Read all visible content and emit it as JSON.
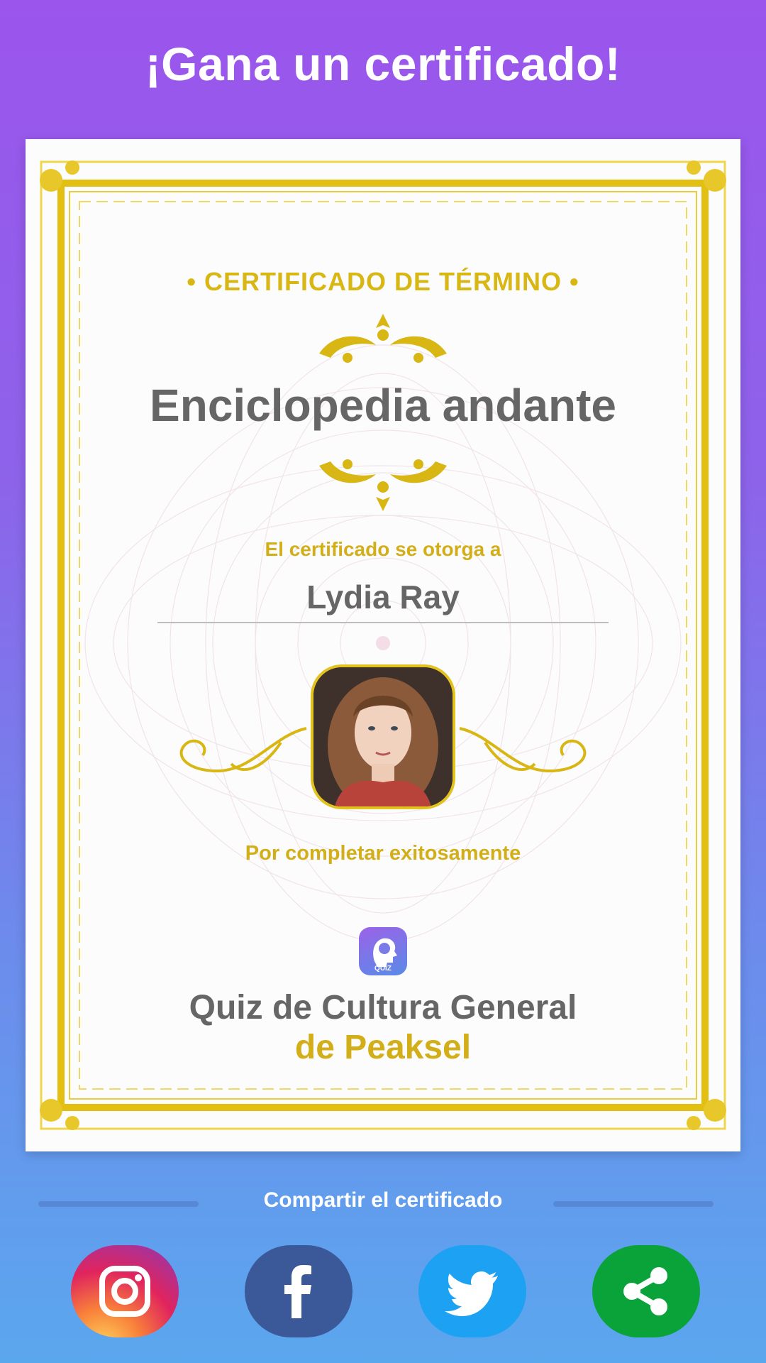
{
  "header": {
    "title": "¡Gana un certificado!"
  },
  "certificate": {
    "heading": "• CERTIFICADO DE TÉRMINO •",
    "title": "Enciclopedia andante",
    "awarded_label": "El certificado se otorga a",
    "recipient_name": "Lydia Ray",
    "completion_label": "Por completar exitosamente",
    "app_icon_text": "QUIZ",
    "app_name": "Quiz de Cultura General",
    "app_publisher": "de Peaksel"
  },
  "share": {
    "label": "Compartir el certificado",
    "buttons": [
      {
        "name": "instagram",
        "icon": "instagram-icon"
      },
      {
        "name": "facebook",
        "icon": "facebook-icon",
        "color": "#3b5998"
      },
      {
        "name": "twitter",
        "icon": "twitter-icon",
        "color": "#1da1f2"
      },
      {
        "name": "share",
        "icon": "share-icon",
        "color": "#0aa33a"
      }
    ]
  },
  "colors": {
    "gold": "#d8b614",
    "text_gray": "#666666",
    "bg_top": "#9b55ec",
    "bg_bottom": "#5ba7ee"
  }
}
